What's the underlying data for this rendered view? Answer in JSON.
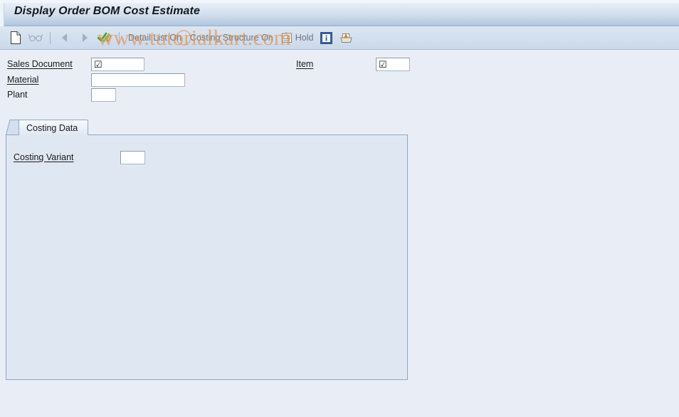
{
  "window": {
    "title": "Display Order BOM Cost Estimate"
  },
  "toolbar": {
    "items": [
      {
        "name": "new-document-button",
        "icon": "document-icon",
        "label": "",
        "enabled": true
      },
      {
        "name": "glasses-button",
        "icon": "glasses-icon",
        "label": "",
        "enabled": false
      },
      {
        "name": "previous-button",
        "icon": "arrow-left-icon",
        "label": "",
        "enabled": false
      },
      {
        "name": "next-button",
        "icon": "arrow-right-icon",
        "label": "",
        "enabled": false
      },
      {
        "name": "check-button",
        "icon": "check-pencil-icon",
        "label": "",
        "enabled": true
      }
    ],
    "detail_list_label": "Detail List On",
    "costing_structure_label": "Costing Structure On",
    "hold_label": "Hold",
    "info_icon": "info-icon",
    "print_icon": "print-icon"
  },
  "header_fields": {
    "sales_document": {
      "label": "Sales Document",
      "value": "☑",
      "placeholder": ""
    },
    "material": {
      "label": "Material",
      "value": "",
      "placeholder": ""
    },
    "plant": {
      "label": "Plant",
      "value": "",
      "placeholder": ""
    },
    "item": {
      "label": "Item",
      "value": "☑",
      "placeholder": ""
    }
  },
  "tabs": [
    {
      "label": "Costing Data",
      "selected": true
    }
  ],
  "costing_data": {
    "costing_variant": {
      "label": "Costing Variant",
      "value": "",
      "placeholder": ""
    }
  },
  "watermark": {
    "text": "www.tutorialkart.com"
  },
  "colors": {
    "page_background": "#e9eef6",
    "panel_background": "#dfe8f2",
    "panel_border": "#8ea9c6",
    "title_text": "#16181c",
    "toolbar_text": "#6e7780",
    "watermark": "#e28b44",
    "accent_blue": "#3b6ea5"
  }
}
